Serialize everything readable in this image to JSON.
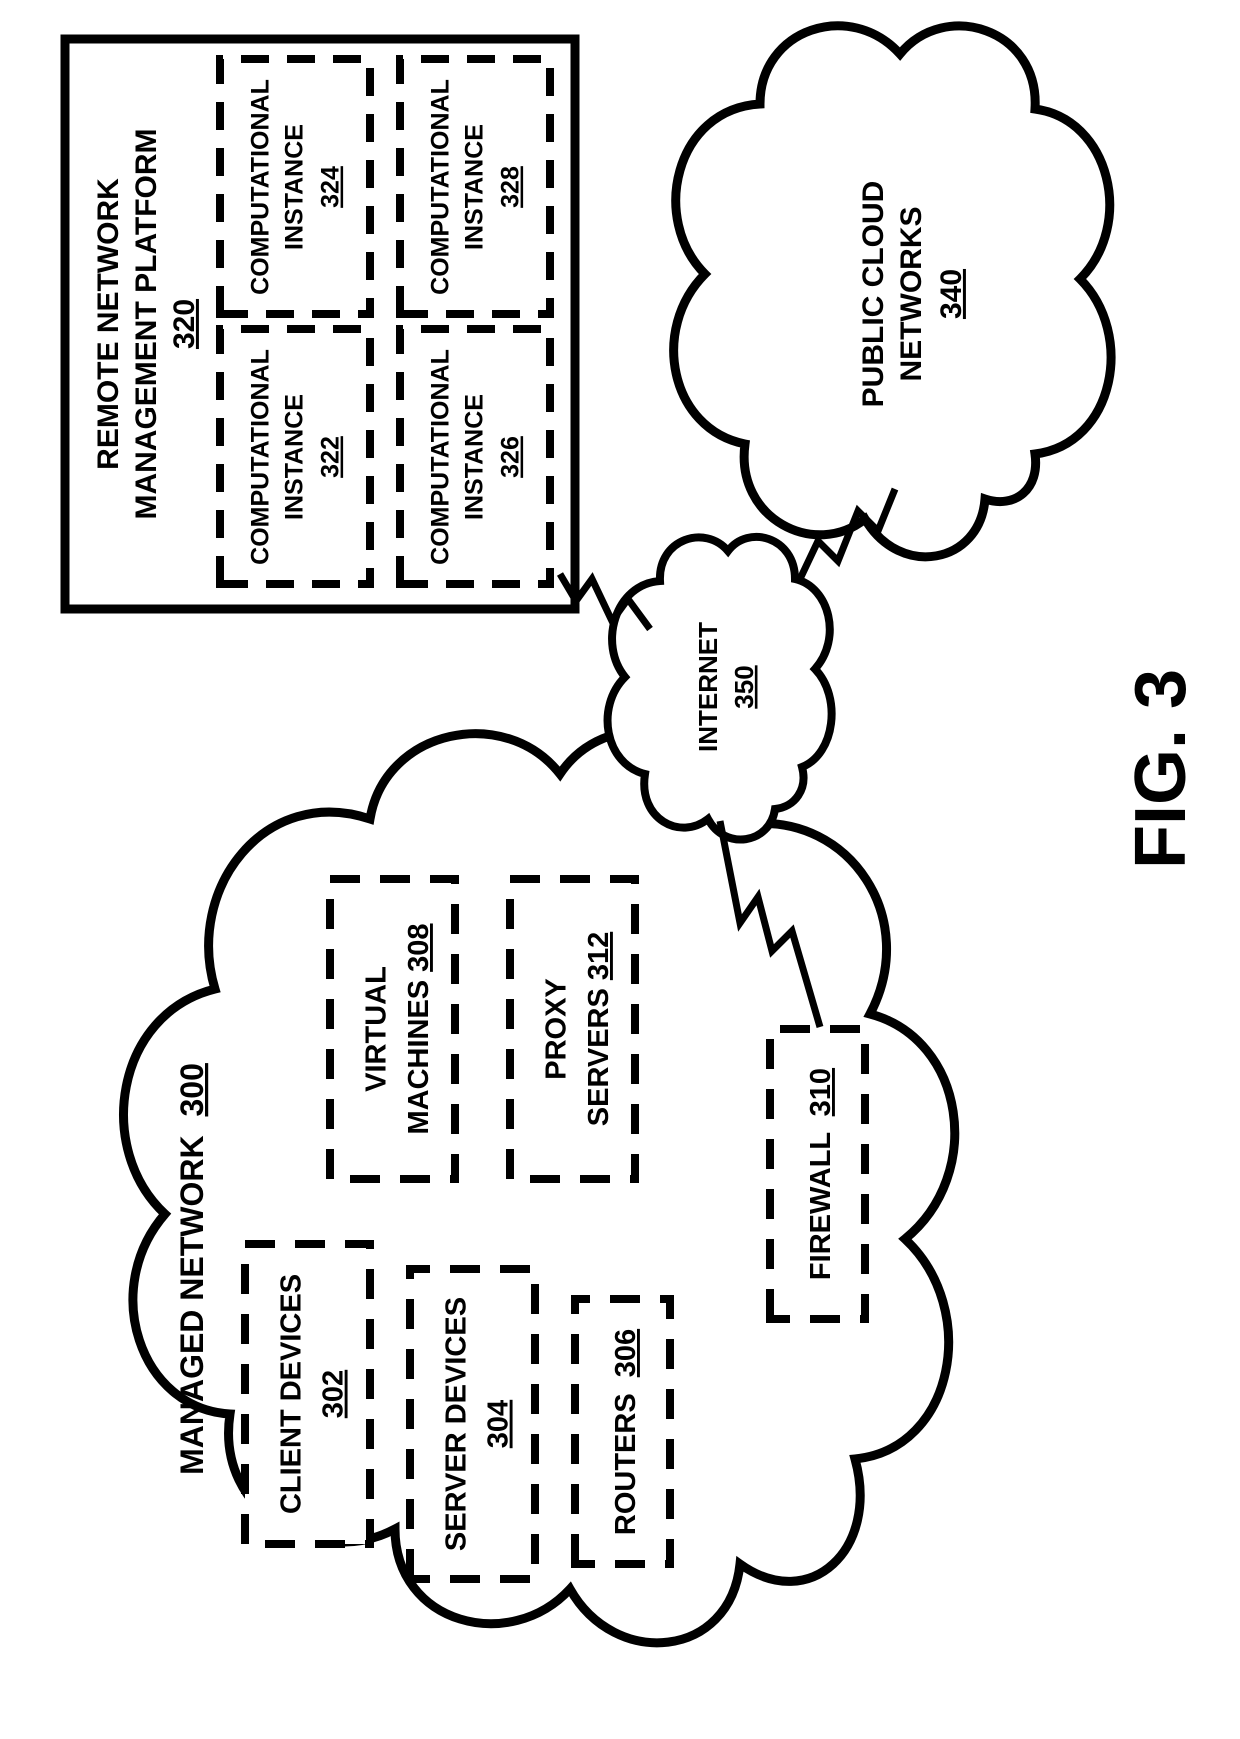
{
  "figure_label": "FIG. 3",
  "managed_network": {
    "title": "MANAGED NETWORK",
    "ref": "300",
    "components": {
      "client_devices": {
        "label": "CLIENT DEVICES",
        "ref": "302"
      },
      "server_devices": {
        "label": "SERVER DEVICES",
        "ref": "304"
      },
      "routers": {
        "label": "ROUTERS",
        "ref": "306"
      },
      "virtual_machines": {
        "label": "VIRTUAL MACHINES",
        "ref": "308"
      },
      "proxy_servers": {
        "label": "PROXY SERVERS",
        "ref": "312"
      },
      "firewall": {
        "label": "FIREWALL",
        "ref": "310"
      }
    }
  },
  "remote_platform": {
    "title_line1": "REMOTE NETWORK",
    "title_line2": "MANAGEMENT PLATFORM",
    "ref": "320",
    "instances": {
      "i322": {
        "label_line1": "COMPUTATIONAL",
        "label_line2": "INSTANCE",
        "ref": "322"
      },
      "i324": {
        "label_line1": "COMPUTATIONAL",
        "label_line2": "INSTANCE",
        "ref": "324"
      },
      "i326": {
        "label_line1": "COMPUTATIONAL",
        "label_line2": "INSTANCE",
        "ref": "326"
      },
      "i328": {
        "label_line1": "COMPUTATIONAL",
        "label_line2": "INSTANCE",
        "ref": "328"
      }
    }
  },
  "public_cloud": {
    "title_line1": "PUBLIC CLOUD",
    "title_line2": "NETWORKS",
    "ref": "340"
  },
  "internet": {
    "label": "INTERNET",
    "ref": "350"
  }
}
